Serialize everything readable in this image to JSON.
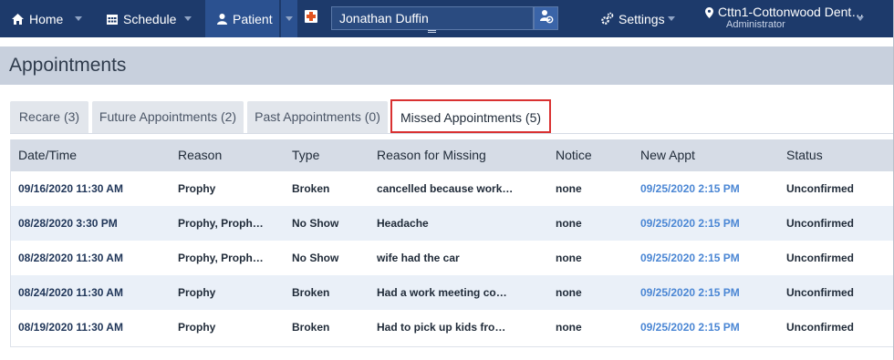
{
  "nav": {
    "home_label": "Home",
    "schedule_label": "Schedule",
    "patient_label": "Patient",
    "search_value": "Jonathan Duffin",
    "settings_label": "Settings",
    "office_name": "Cttn1-Cottonwood Dent…",
    "office_role": "Administrator",
    "icons": {
      "home": "home-icon",
      "schedule": "calendar-icon",
      "patient": "person-icon",
      "add_patient": "add-patient-icon",
      "search": "patient-search-icon",
      "settings": "gear-icon",
      "office": "map-pin-icon"
    }
  },
  "page": {
    "title": "Appointments"
  },
  "tabs": [
    {
      "label": "Recare (3)"
    },
    {
      "label": "Future Appointments (2)"
    },
    {
      "label": "Past Appointments (0)"
    },
    {
      "label": "Missed Appointments (5)",
      "active": true
    }
  ],
  "table": {
    "headers": [
      "Date/Time",
      "Reason",
      "Type",
      "Reason for Missing",
      "Notice",
      "New Appt",
      "Status"
    ],
    "rows": [
      {
        "date": "09/16/2020 11:30 AM",
        "reason": "Prophy",
        "type": "Broken",
        "missing": "cancelled because work…",
        "notice": "none",
        "new_appt": "09/25/2020 2:15 PM",
        "status": "Unconfirmed"
      },
      {
        "date": "08/28/2020 3:30 PM",
        "reason": "Prophy, Proph…",
        "type": "No Show",
        "missing": "Headache",
        "notice": "none",
        "new_appt": "09/25/2020 2:15 PM",
        "status": "Unconfirmed"
      },
      {
        "date": "08/28/2020 11:30 AM",
        "reason": "Prophy, Proph…",
        "type": "No Show",
        "missing": "wife had the car",
        "notice": "none",
        "new_appt": "09/25/2020 2:15 PM",
        "status": "Unconfirmed"
      },
      {
        "date": "08/24/2020 11:30 AM",
        "reason": "Prophy",
        "type": "Broken",
        "missing": "Had a work meeting co…",
        "notice": "none",
        "new_appt": "09/25/2020 2:15 PM",
        "status": "Unconfirmed"
      },
      {
        "date": "08/19/2020 11:30 AM",
        "reason": "Prophy",
        "type": "Broken",
        "missing": "Had to pick up kids fro…",
        "notice": "none",
        "new_appt": "09/25/2020 2:15 PM",
        "status": "Unconfirmed"
      }
    ]
  },
  "colors": {
    "nav_bg": "#1d3a6b",
    "nav_active": "#2b5190",
    "title_bar": "#c8d0dd",
    "link": "#4a86d4",
    "active_tab_border": "#d93131"
  }
}
